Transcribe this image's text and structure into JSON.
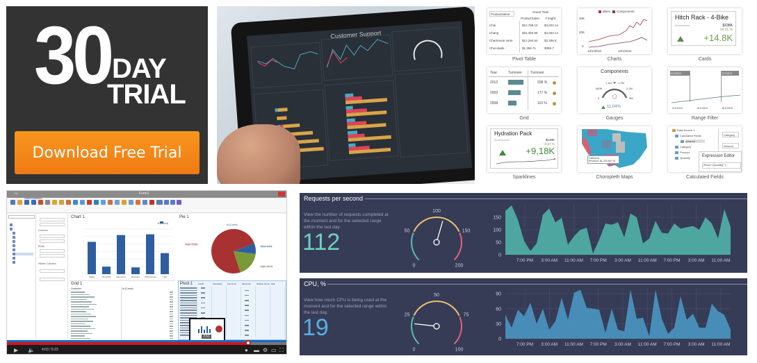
{
  "trial": {
    "big_number": "30",
    "day": "DAY",
    "trial": "TRIAL",
    "button_label": "Download Free Trial",
    "button_color": "#f7891a"
  },
  "tablet": {
    "dashboard_title": "Customer Support",
    "legend_colors": [
      "#4aa8c4",
      "#e0425a",
      "#d9a44a"
    ]
  },
  "features": [
    {
      "caption": "Pivot Table",
      "pivot": {
        "filter": "ProductName",
        "header": "Grand Total",
        "cols": [
          "ProductSales",
          "Freight"
        ],
        "rows": [
          [
            "Chai",
            "$12,788.10",
            "$3,022.14"
          ],
          [
            "Chang",
            "$16,355.96",
            "$4,553.14"
          ],
          [
            "Chartreuse verte",
            "$12,294.54",
            "$2,406.8"
          ],
          [
            "Chocolade",
            "$1,368.71",
            "$389.7"
          ]
        ]
      }
    },
    {
      "caption": "Charts",
      "legend": [
        "Bikes",
        "Components"
      ],
      "y_ticks": [
        "40K",
        "20K",
        "0"
      ],
      "x_ticks": [
        "12/1/2010",
        "12/1/2011"
      ]
    },
    {
      "caption": "Cards",
      "title": "Hitch Rack - 4-Bike",
      "subtitle": "Accessories",
      "target": "$338K",
      "pct": "14.21 %",
      "delta": "+14.8K"
    },
    {
      "caption": "Grid",
      "cols": [
        "Year",
        "Turnover",
        "Turnover"
      ],
      "rows": [
        [
          "2012",
          "208 %"
        ],
        [
          "2009",
          "177 %"
        ],
        [
          "2008",
          "110 %"
        ]
      ]
    },
    {
      "caption": "Gauges",
      "title": "Components",
      "ticks": [
        "0",
        "560K",
        "1.1M",
        "1.7M",
        "2.2M",
        "3M"
      ],
      "delta": "11.04%"
    },
    {
      "caption": "Range Filter",
      "start": "2/1/2011",
      "end": "7/1/2011",
      "x_ticks": [
        "2/1/2011",
        "5/1/2011",
        "8/1/2011"
      ]
    },
    {
      "caption": "Sparklines",
      "title": "Hydration Pack",
      "subtitle": "Accessories",
      "target": "$130K",
      "pct": "+9.57 %",
      "delta": "+9,18K"
    },
    {
      "caption": "Choropleth Maps",
      "tooltip_title": "California",
      "tooltip_value": "Revenue: $1,234,567.00"
    },
    {
      "caption": "Calculated Fields",
      "tree": [
        "Data Source 1",
        "Calculated Fields",
        "Amount",
        "Category",
        "Product",
        "Quantity"
      ],
      "right": [
        "Category",
        "Amount"
      ],
      "editor_title": "Expression Editor",
      "expression": "[Price] * [Quantity] * [..."
    }
  ],
  "video": {
    "window_title": "Form1",
    "tabs": [
      "File",
      "Dashboard",
      "Data"
    ],
    "chart_title": "Chart 1",
    "chart_legend": "Id (Count)",
    "chart_categories": [
      "Dallas",
      "Mansfield",
      "Oak Grove",
      "Richland",
      "Willowbrook",
      "Hall"
    ],
    "chart_values": [
      4.3,
      1.0,
      5.2,
      0.9,
      5.3,
      2.8
    ],
    "pie_title": "Pie 1",
    "pie_subtitle": "Id (Count)",
    "pie_labels": [
      "Ross: 73.9%",
      "Other: 8.0%",
      "Clark: 18.1%"
    ],
    "pie_values": [
      73.9,
      8.0,
      18.1
    ],
    "grid_title": "Grid 1",
    "grid_cols": [
      "Customer",
      "Id (Count)"
    ],
    "pivot_title": "Pivot 1",
    "pivot_cols": [
      "Austin",
      "Cleveland",
      "Fort Knox",
      "Memorial",
      "Shelton Grove",
      "Hall"
    ],
    "sidebar_values": [
      "Columns",
      "Rows",
      "Hidden Columns"
    ],
    "preview_time": "3:53",
    "current_time": "4:03 / 5:23",
    "progress_fraction": 0.86
  },
  "requests": {
    "title": "Requests per second",
    "description": "View the number of requests completed at the moment and for the selected range within the last day.",
    "value": "112",
    "value_color": "#6fcfc0",
    "gauge": {
      "min": 0,
      "max": 200,
      "value": 112,
      "ticks": [
        "0",
        "50",
        "100",
        "150",
        "200"
      ]
    },
    "chart_data": {
      "type": "area",
      "y_ticks": [
        "150",
        "100",
        "50",
        "0"
      ],
      "ylim": [
        0,
        200
      ],
      "x_ticks": [
        "7:00 PM",
        "3:00 AM",
        "11:00 AM",
        "7:00 PM",
        "3:00 AM",
        "11:00 AM",
        "7:00 PM",
        "3:00 AM",
        "11:00 AM"
      ],
      "values": [
        175,
        198,
        140,
        55,
        15,
        45,
        160,
        185,
        130,
        148,
        40,
        75,
        100,
        108,
        5,
        60,
        125,
        120,
        130,
        70,
        165,
        150,
        45,
        65,
        135,
        88,
        85,
        125,
        105,
        110,
        115,
        100,
        150,
        125,
        65,
        182,
        112
      ],
      "color": "#4fb0a5"
    }
  },
  "cpu": {
    "title": "CPU, %",
    "description": "View how much CPU is being used at the moment and for the selected range within the last day.",
    "value": "19",
    "value_color": "#5aaee0",
    "gauge": {
      "min": 0,
      "max": 100,
      "value": 19,
      "ticks": [
        "0",
        "25",
        "50",
        "75",
        "100"
      ]
    },
    "chart_data": {
      "type": "area",
      "y_ticks": [
        "90",
        "60",
        "30",
        "0"
      ],
      "ylim": [
        0,
        100
      ],
      "x_ticks": [
        "7:00 PM",
        "3:00 AM",
        "11:00 AM",
        "7:00 PM",
        "3:00 AM",
        "11:00 AM",
        "7:00 PM",
        "3:00 AM",
        "11:00 AM"
      ],
      "values": [
        48,
        22,
        58,
        45,
        72,
        30,
        60,
        18,
        35,
        82,
        38,
        92,
        98,
        62,
        60,
        58,
        12,
        60,
        18,
        15,
        98,
        40,
        42,
        5,
        98,
        40,
        10,
        22,
        85,
        38,
        50,
        22,
        22,
        70,
        55,
        48,
        18
      ],
      "color": "#4a94c0"
    }
  }
}
